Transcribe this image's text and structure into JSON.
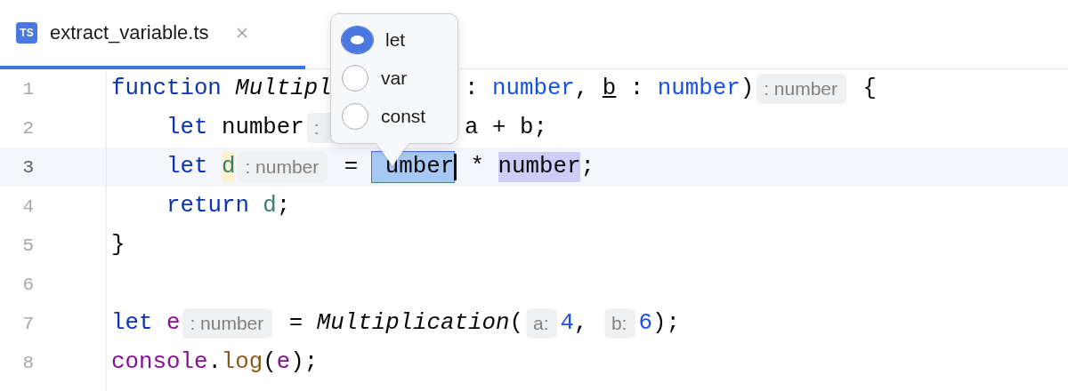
{
  "tab": {
    "icon_text": "TS",
    "label": "extract_variable.ts",
    "selected": true
  },
  "lines": [
    {
      "number": "1",
      "current": false,
      "tokens": [
        {
          "kind": "keyword",
          "text": "function"
        },
        {
          "kind": "fn",
          "text": "Multipl"
        },
        {
          "kind": "gap"
        },
        {
          "kind": "plain",
          "text": ": "
        },
        {
          "kind": "type",
          "text": "number"
        },
        {
          "kind": "plain",
          "text": ", "
        },
        {
          "kind": "param",
          "text": "b"
        },
        {
          "kind": "plain",
          "text": " : "
        },
        {
          "kind": "type",
          "text": "number"
        },
        {
          "kind": "plain",
          "text": ")"
        },
        {
          "kind": "hint",
          "text": ": number"
        },
        {
          "kind": "plain",
          "text": " {"
        }
      ],
      "children": [
        {
          "number": "2",
          "current": false,
          "tokens": [
            {
              "kind": "keyword",
              "text": "let"
            },
            {
              "kind": "plain",
              "text": "number"
            },
            {
              "kind": "hint",
              "text": ":"
            },
            {
              "kind": "gap"
            },
            {
              "kind": "plain",
              "text": "a + b;"
            }
          ]
        },
        {
          "number": "3",
          "current": true,
          "tokens": [
            {
              "kind": "keyword",
              "text": "let"
            },
            {
              "kind": "decl",
              "text": "d"
            },
            {
              "kind": "hint",
              "text": ": number"
            },
            {
              "kind": "plain",
              "text": " = "
            },
            {
              "kind": "sel",
              "text": "umber"
            },
            {
              "kind": "caret"
            },
            {
              "kind": "plain",
              "text": " * "
            },
            {
              "kind": "ref",
              "text": "number"
            },
            {
              "kind": "plain",
              "text": ";"
            }
          ]
        },
        {
          "number": "4",
          "current": false,
          "tokens": [
            {
              "kind": "keyword",
              "text": "return"
            },
            {
              "kind": "local",
              "text": "d"
            },
            {
              "kind": "plain",
              "text": ";"
            }
          ]
        }
      ]
    },
    {
      "number": "5",
      "current": false,
      "tokens": [
        {
          "kind": "plain",
          "text": "}"
        }
      ]
    },
    {
      "number": "6",
      "current": false
    },
    {
      "number": "7",
      "current": false,
      "tokens": [
        {
          "kind": "keyword",
          "text": "let"
        },
        {
          "kind": "global",
          "text": "e"
        },
        {
          "kind": "hint",
          "text": ": number"
        },
        {
          "kind": "plain",
          "text": " = "
        },
        {
          "kind": "fn",
          "text": "Multiplication"
        },
        {
          "kind": "plain",
          "text": "("
        },
        {
          "kind": "hint",
          "text": "a:"
        },
        {
          "kind": "num",
          "text": "4"
        },
        {
          "kind": "plain",
          "text": ", "
        },
        {
          "kind": "hint",
          "text": "b:"
        },
        {
          "kind": "num",
          "text": "6"
        },
        {
          "kind": "plain",
          "text": ");"
        }
      ]
    },
    {
      "number": "8",
      "current": false,
      "tokens": [
        {
          "kind": "global",
          "text": "console"
        },
        {
          "kind": "plain",
          "text": "."
        },
        {
          "kind": "method",
          "text": "log"
        },
        {
          "kind": "plain",
          "text": "("
        },
        {
          "kind": "global",
          "text": "e"
        },
        {
          "kind": "plain",
          "text": ");"
        }
      ]
    }
  ],
  "popup": {
    "options": [
      {
        "label": "let",
        "selected": true
      },
      {
        "label": "var",
        "selected": false
      },
      {
        "label": "const",
        "selected": false
      }
    ]
  }
}
